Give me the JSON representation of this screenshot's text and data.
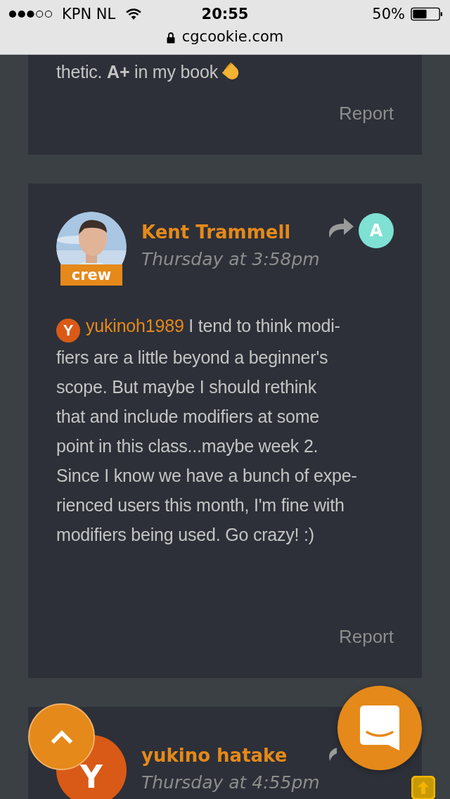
{
  "status_bar": {
    "carrier": "KPN NL",
    "time": "20:55",
    "battery": "50%"
  },
  "address_bar": {
    "url": "cgcookie.com"
  },
  "comments": [
    {
      "lines": [
        "thetic. **A+** in my book"
      ],
      "report": "Report"
    },
    {
      "author": "Kent Trammell",
      "badge": "crew",
      "time": "Thursday at 3:58pm",
      "reply_to": "A",
      "mention_avatar": "Y",
      "mention": "yukinoh1989",
      "lines": [
        "I tend to think modi-",
        "fiers are a little beyond a beginner's",
        "scope. But maybe I should rethink",
        "that and include modifiers at some",
        "point in this class...maybe week 2.",
        "Since I know we have a bunch of expe-",
        "rienced users this month, I'm fine with",
        "modifiers being used. Go crazy! :)"
      ],
      "report": "Report"
    },
    {
      "author": "yukino hatake",
      "avatar": {
        "kind": "letter",
        "letter": "Y"
      },
      "time": "Thursday at 4:55pm"
    }
  ]
}
